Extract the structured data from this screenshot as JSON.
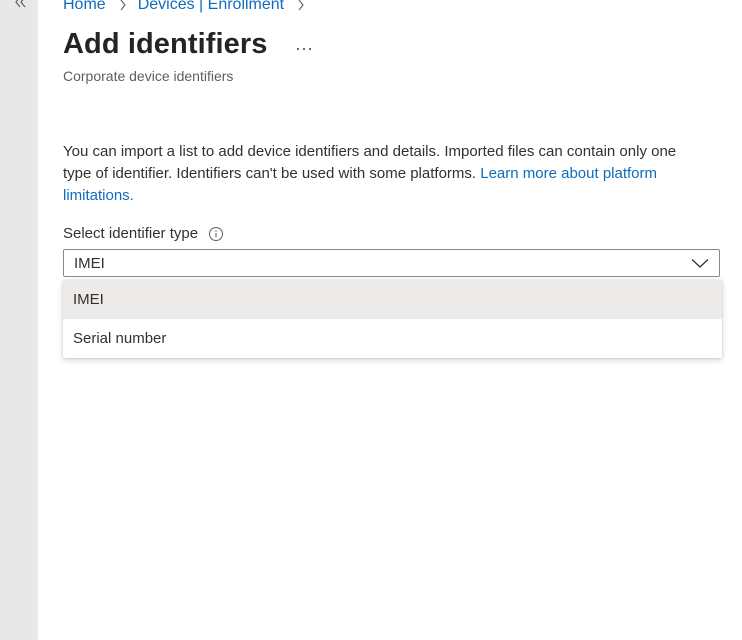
{
  "breadcrumb": {
    "items": [
      {
        "label": "Home"
      },
      {
        "label": "Devices | Enrollment"
      }
    ]
  },
  "header": {
    "title": "Add identifiers",
    "more_label": "...",
    "subtitle": "Corporate device identifiers"
  },
  "description": {
    "text": "You can import a list to add device identifiers and details. Imported files can contain only one type of identifier. Identifiers can't be used with some platforms. ",
    "link": "Learn more about platform limitations."
  },
  "identifier_type": {
    "label": "Select identifier type",
    "selected": "IMEI",
    "options": [
      {
        "label": "IMEI",
        "selected": true
      },
      {
        "label": "Serial number",
        "selected": false
      }
    ]
  },
  "colors": {
    "link": "#0f6cbd",
    "rail": "#e8e8e8",
    "selected_option_bg": "#edebe9"
  },
  "icons": [
    "collapse-left-icon",
    "chevron-right-icon",
    "more-icon",
    "info-icon",
    "chevron-down-icon"
  ]
}
